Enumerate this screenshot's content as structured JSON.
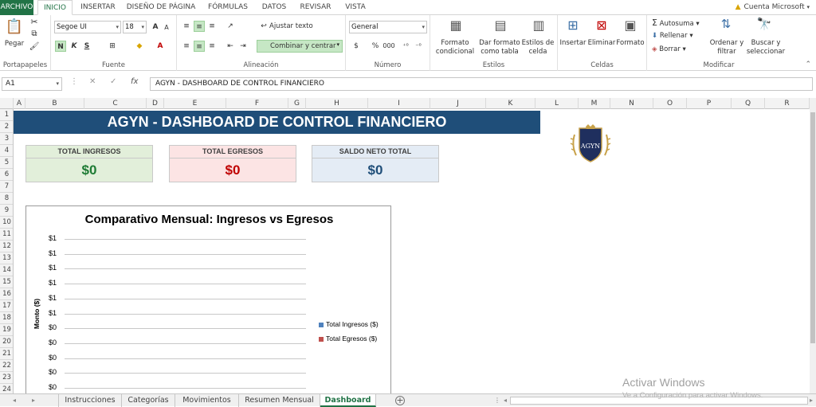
{
  "ribbon_tabs": [
    "ARCHIVO",
    "INICIO",
    "INSERTAR",
    "DISEÑO DE PÁGINA",
    "FÓRMULAS",
    "DATOS",
    "REVISAR",
    "VISTA"
  ],
  "account": "Cuenta Microsoft",
  "ribbon": {
    "paste": "Pegar",
    "font_name": "Segoe UI",
    "font_size": "18",
    "bold": "N",
    "italic": "K",
    "underline": "S",
    "wrap_text": "Ajustar texto",
    "merge_center": "Combinar y centrar",
    "number_format": "General",
    "currency": "$",
    "percent": "%",
    "thousands": "000",
    "cond_format": [
      "Formato",
      "condicional"
    ],
    "format_table": [
      "Dar formato",
      "como tabla"
    ],
    "cell_styles": [
      "Estilos de",
      "celda"
    ],
    "insert": "Insertar",
    "delete": "Eliminar",
    "format": "Formato",
    "autosum": "Autosuma",
    "fill": "Rellenar",
    "clear": "Borrar",
    "sort_filter": [
      "Ordenar y",
      "filtrar"
    ],
    "find_select": [
      "Buscar y",
      "seleccionar"
    ],
    "groups": [
      "Portapapeles",
      "Fuente",
      "Alineación",
      "Número",
      "Estilos",
      "Celdas",
      "Modificar"
    ]
  },
  "formula_bar": {
    "name_box": "A1",
    "fx": "fx",
    "formula": "AGYN - DASHBOARD DE CONTROL FINANCIERO"
  },
  "columns": [
    "A",
    "B",
    "C",
    "D",
    "E",
    "F",
    "G",
    "H",
    "I",
    "J",
    "K",
    "L",
    "M",
    "N",
    "O",
    "P",
    "Q",
    "R"
  ],
  "rows": [
    "1",
    "2",
    "3",
    "4",
    "5",
    "6",
    "7",
    "8",
    "9",
    "10",
    "11",
    "12",
    "13",
    "14",
    "15",
    "16",
    "17",
    "18",
    "19",
    "20",
    "21",
    "22",
    "23",
    "24"
  ],
  "dashboard": {
    "title": "AGYN - DASHBOARD DE CONTROL FINANCIERO",
    "logo_text": "AGYN",
    "cards": [
      {
        "label": "TOTAL INGRESOS",
        "value": "$0",
        "color": "#1e7b34",
        "bg": "#e2efda"
      },
      {
        "label": "TOTAL EGRESOS",
        "value": "$0",
        "color": "#c00000",
        "bg": "#fce4e4"
      },
      {
        "label": "SALDO NETO TOTAL",
        "value": "$0",
        "color": "#1f4e79",
        "bg": "#e4ecf5"
      }
    ]
  },
  "chart_data": {
    "type": "bar",
    "title": "Comparativo Mensual: Ingresos vs Egresos",
    "ylabel": "Monto ($)",
    "xlabel": "",
    "categories": [],
    "y_tick_labels": [
      "$1",
      "$1",
      "$1",
      "$1",
      "$1",
      "$1",
      "$0",
      "$0",
      "$0",
      "$0",
      "$0"
    ],
    "series": [
      {
        "name": "Total Ingresos ($)",
        "values": [],
        "color": "#4f81bd"
      },
      {
        "name": "Total Egresos ($)",
        "values": [],
        "color": "#c0504d"
      }
    ],
    "legend": "right",
    "grid": true
  },
  "sheet_tabs": [
    "Instrucciones",
    "Categorías",
    "Movimientos",
    "Resumen Mensual",
    "Dashboard"
  ],
  "active_sheet": "Dashboard",
  "watermark": {
    "line1": "Activar Windows",
    "line2": "Ve a Configuración para activar Windows."
  }
}
